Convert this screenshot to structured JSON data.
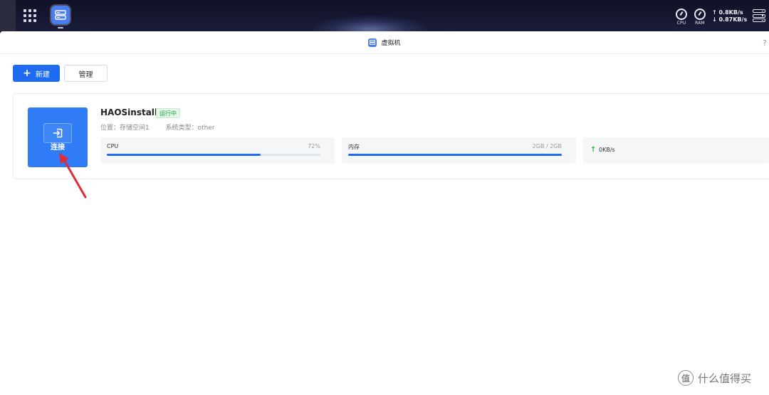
{
  "taskbar": {
    "monitors": [
      {
        "label": "CPU"
      },
      {
        "label": "RAM"
      }
    ],
    "upload_rate": "↑ 0.8KB/s",
    "download_rate": "↓ 0.87KB/s"
  },
  "window": {
    "title": "虚拟机",
    "help": "?"
  },
  "toolbar": {
    "new_plus": "+",
    "new_label": "新建",
    "manage_label": "管理"
  },
  "vm": {
    "connect_label": "连接",
    "name": "HAOSinstall",
    "status": "运行中",
    "location": "位置：存储空间1",
    "os_type": "系统类型：other",
    "cpu": {
      "label": "CPU",
      "value": "72%",
      "fraction": 0.72
    },
    "memory": {
      "label": "内存",
      "value": "2GB / 2GB",
      "fraction": 1.0
    },
    "network": {
      "arrow": "↑",
      "value": "0KB/s"
    }
  },
  "colors": {
    "accent": "#1e6bf1",
    "status_green": "#1f9d4a",
    "annotation_red": "#e02b3a"
  },
  "watermark": {
    "logo_char": "值",
    "text": "什么值得买"
  }
}
